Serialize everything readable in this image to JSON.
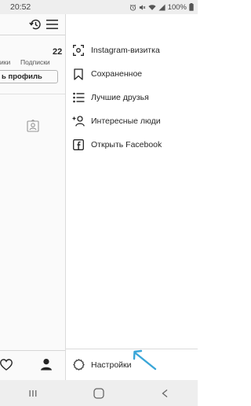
{
  "status_bar": {
    "time": "20:52",
    "battery_percent": "100%",
    "icons": [
      "alarm-icon",
      "mute-icon",
      "wifi-icon",
      "signal-icon",
      "battery-icon"
    ]
  },
  "profile_background": {
    "following_count": "22",
    "followers_label_partial": "ики",
    "following_label": "Подписки",
    "edit_profile_label": "ь профиль",
    "header_icons": [
      "history-icon",
      "menu-icon"
    ],
    "bottom_icons": [
      "heart-icon",
      "profile-icon"
    ]
  },
  "drawer": {
    "items": [
      {
        "label": "Instagram-визитка",
        "icon": "nametag-icon"
      },
      {
        "label": "Сохраненное",
        "icon": "bookmark-icon"
      },
      {
        "label": "Лучшие друзья",
        "icon": "close-friends-icon"
      },
      {
        "label": "Интересные люди",
        "icon": "discover-people-icon"
      },
      {
        "label": "Открыть Facebook",
        "icon": "facebook-icon"
      }
    ],
    "settings": {
      "label": "Настройки",
      "icon": "settings-gear-icon"
    }
  },
  "annotation": {
    "arrow_color": "#3aa6d8"
  },
  "nav_bar": {
    "buttons": [
      "recent-apps-icon",
      "home-icon",
      "back-icon"
    ]
  },
  "colors": {
    "text": "#262626",
    "divider": "#dbdbdb",
    "system_bar": "#eeeeee"
  }
}
